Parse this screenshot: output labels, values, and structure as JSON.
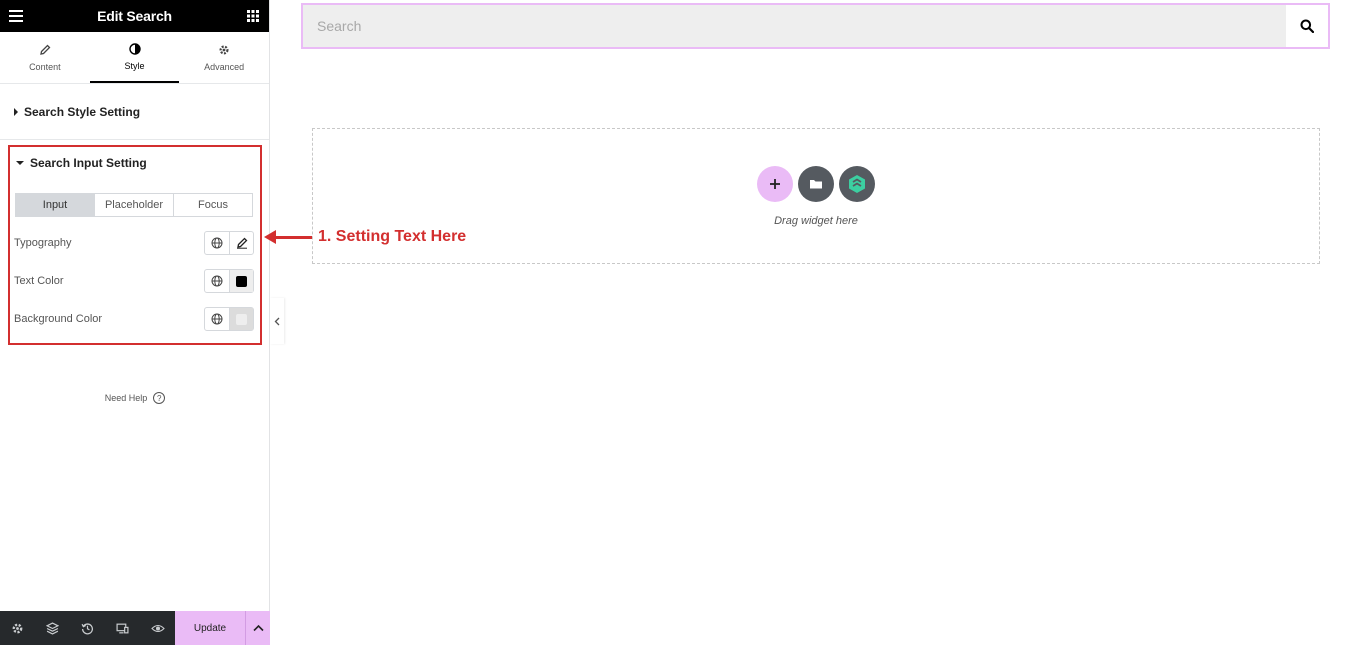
{
  "header": {
    "title": "Edit Search"
  },
  "tabs": [
    {
      "label": "Content",
      "icon": "pencil-icon"
    },
    {
      "label": "Style",
      "icon": "contrast-icon"
    },
    {
      "label": "Advanced",
      "icon": "gear-icon"
    }
  ],
  "sections": {
    "style_setting": "Search Style Setting",
    "input_setting": "Search Input Setting"
  },
  "state_tabs": [
    "Input",
    "Placeholder",
    "Focus"
  ],
  "controls": {
    "typography": "Typography",
    "text_color": "Text Color",
    "background_color": "Background Color"
  },
  "colors": {
    "text_color_value": "#000000",
    "background_color_value": "#eeeeee",
    "accent": "#eabbf6",
    "annotation": "#d32f2f"
  },
  "help": {
    "label": "Need Help"
  },
  "footer": {
    "update_label": "Update"
  },
  "canvas": {
    "search_placeholder": "Search",
    "drag_label": "Drag widget here"
  },
  "annotation": {
    "text": "1. Setting Text Here"
  }
}
